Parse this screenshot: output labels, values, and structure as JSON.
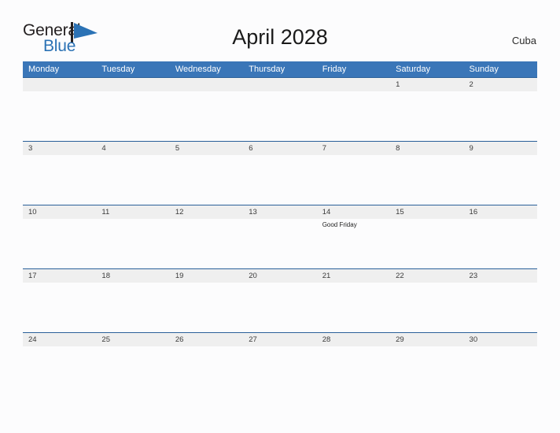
{
  "header": {
    "logo": {
      "line1": "General",
      "line2": "Blue",
      "flag_icon": "blue-flag-triangle-icon",
      "text_color": "#231f20",
      "accent_color": "#2b72b5"
    },
    "title": "April 2028",
    "country": "Cuba"
  },
  "theme": {
    "header_blue": "#3a76b8",
    "rule_blue": "#2a6099",
    "daynum_band": "#efefef",
    "page_background": "#fcfcfd"
  },
  "calendar": {
    "weekday_headers": [
      "Monday",
      "Tuesday",
      "Wednesday",
      "Thursday",
      "Friday",
      "Saturday",
      "Sunday"
    ],
    "weeks": [
      {
        "days": [
          {
            "date": "",
            "event": ""
          },
          {
            "date": "",
            "event": ""
          },
          {
            "date": "",
            "event": ""
          },
          {
            "date": "",
            "event": ""
          },
          {
            "date": "",
            "event": ""
          },
          {
            "date": "1",
            "event": ""
          },
          {
            "date": "2",
            "event": ""
          }
        ]
      },
      {
        "days": [
          {
            "date": "3",
            "event": ""
          },
          {
            "date": "4",
            "event": ""
          },
          {
            "date": "5",
            "event": ""
          },
          {
            "date": "6",
            "event": ""
          },
          {
            "date": "7",
            "event": ""
          },
          {
            "date": "8",
            "event": ""
          },
          {
            "date": "9",
            "event": ""
          }
        ]
      },
      {
        "days": [
          {
            "date": "10",
            "event": ""
          },
          {
            "date": "11",
            "event": ""
          },
          {
            "date": "12",
            "event": ""
          },
          {
            "date": "13",
            "event": ""
          },
          {
            "date": "14",
            "event": "Good Friday"
          },
          {
            "date": "15",
            "event": ""
          },
          {
            "date": "16",
            "event": ""
          }
        ]
      },
      {
        "days": [
          {
            "date": "17",
            "event": ""
          },
          {
            "date": "18",
            "event": ""
          },
          {
            "date": "19",
            "event": ""
          },
          {
            "date": "20",
            "event": ""
          },
          {
            "date": "21",
            "event": ""
          },
          {
            "date": "22",
            "event": ""
          },
          {
            "date": "23",
            "event": ""
          }
        ]
      },
      {
        "days": [
          {
            "date": "24",
            "event": ""
          },
          {
            "date": "25",
            "event": ""
          },
          {
            "date": "26",
            "event": ""
          },
          {
            "date": "27",
            "event": ""
          },
          {
            "date": "28",
            "event": ""
          },
          {
            "date": "29",
            "event": ""
          },
          {
            "date": "30",
            "event": ""
          }
        ]
      }
    ]
  }
}
